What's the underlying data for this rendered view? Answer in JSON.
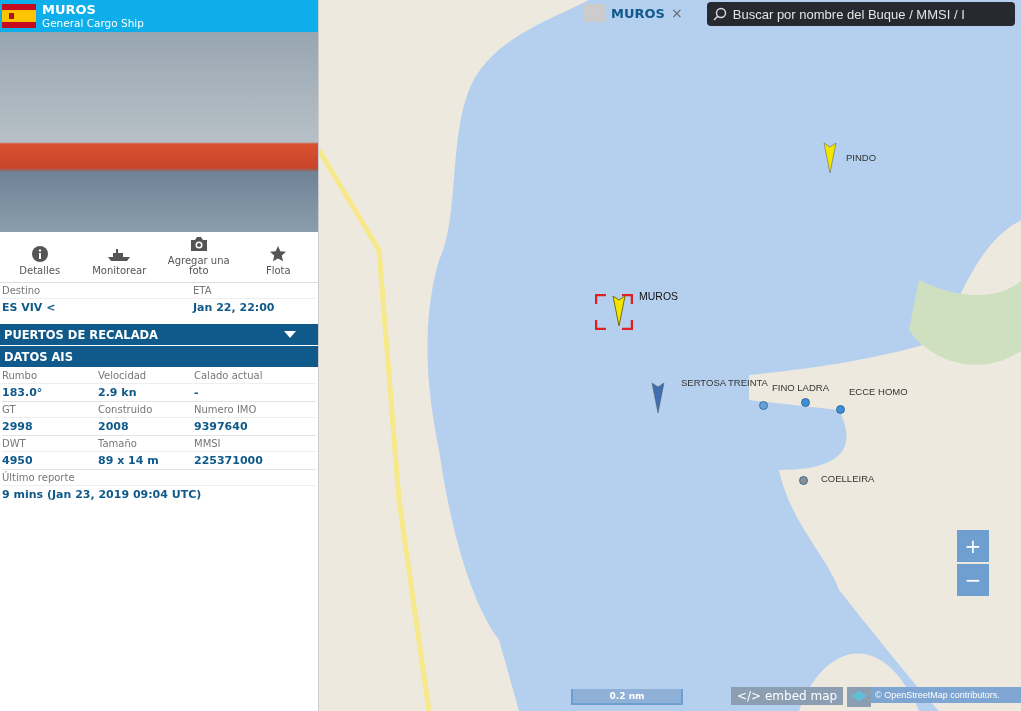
{
  "vessel": {
    "name": "MUROS",
    "type": "General Cargo Ship"
  },
  "actions": [
    {
      "label": "Detalles"
    },
    {
      "label": "Monitorear"
    },
    {
      "label": "Agregar una foto"
    },
    {
      "label": "Flota"
    }
  ],
  "voyage": [
    {
      "label": "Destino",
      "value": "ES VIV <"
    },
    {
      "label": "ETA",
      "value": "Jan 22, 22:00"
    }
  ],
  "sections": [
    {
      "title": "PUERTOS DE RECALADA",
      "kind": "collapsible"
    },
    {
      "title": "DATOS AIS",
      "kind": "header"
    }
  ],
  "ais": [
    {
      "label": "Rumbo",
      "value": "183.0°"
    },
    {
      "label": "Velocidad",
      "value": "2.9 kn"
    },
    {
      "label": "Calado actual",
      "value": "-"
    },
    {
      "label": "GT",
      "value": "2998"
    },
    {
      "label": "Construido",
      "value": "2008"
    },
    {
      "label": "Numero IMO",
      "value": "9397640"
    },
    {
      "label": "DWT",
      "value": "4950"
    },
    {
      "label": "Tamaño",
      "value": "89 x 14 m"
    },
    {
      "label": "MMSI",
      "value": "225371000"
    }
  ],
  "last_report": {
    "label": "Último reporte",
    "value": "9 mins (Jan 23, 2019 09:04 UTC)"
  },
  "map": {
    "tab": {
      "label": "MUROS",
      "close": "×"
    },
    "search": {
      "placeholder": "Buscar por nombre del Buque / MMSI / I"
    },
    "vessels": [
      {
        "name": "MUROS",
        "kind": "arrow",
        "color": "#f2e600",
        "selected": true
      },
      {
        "name": "PINDO",
        "kind": "arrow",
        "color": "#f2e600",
        "selected": false
      },
      {
        "kind": "arrow",
        "color": "#3f6fb0",
        "selected": false
      },
      {
        "name": "SERTOSA TREINTA",
        "kind": "dot",
        "color": "#6aa0d8",
        "selected": false
      },
      {
        "name": "FINO LADRA",
        "kind": "dot",
        "color": "#3a8fd8",
        "selected": false
      },
      {
        "name": "ECCE HOMO",
        "kind": "dot",
        "color": "#3a8fd8",
        "selected": false
      },
      {
        "name": "COELLEIRA",
        "kind": "dot",
        "color": "#8a8f96",
        "selected": false
      }
    ],
    "zoom": [
      "+",
      "−"
    ],
    "scale": "0.2 nm",
    "embed": "</> embed map",
    "attribution": "© OpenStreetMap contributors."
  }
}
